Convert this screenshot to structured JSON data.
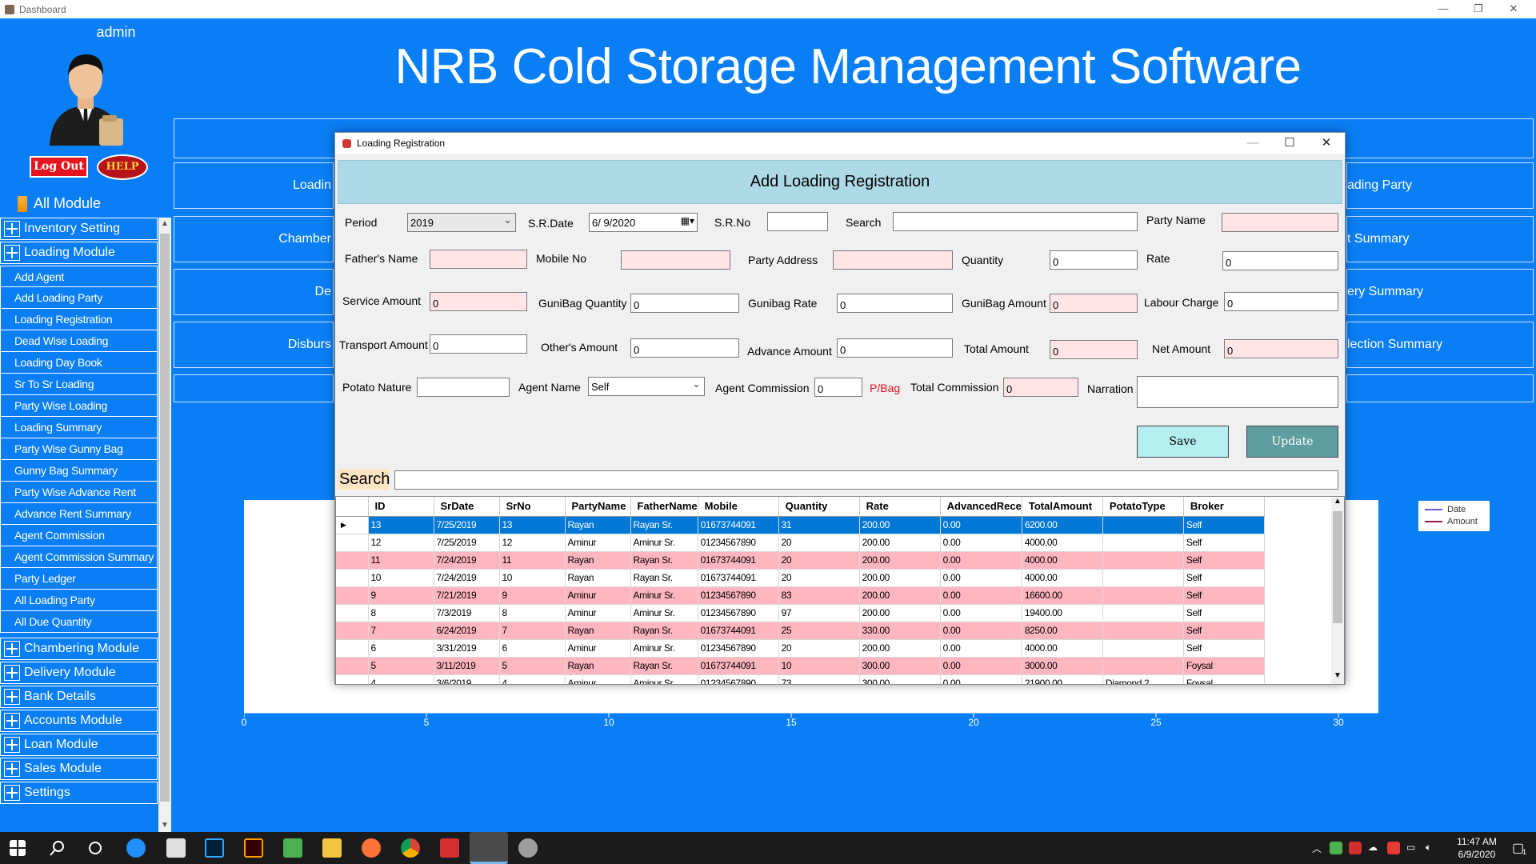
{
  "window": {
    "title": "Dashboard",
    "minimize": "—",
    "restore": "❐",
    "close": "✕"
  },
  "app_title": "NRB Cold Storage Management Software",
  "user": {
    "name": "admin",
    "logout_label": "Log Out",
    "help_label": "HELP"
  },
  "all_module_label": "All Module",
  "sidebar": {
    "modules_top": [
      {
        "label": "Inventory Setting"
      },
      {
        "label": "Loading Module"
      }
    ],
    "loading_items": [
      "Add Agent",
      "Add Loading Party",
      "Loading Registration",
      "Dead Wise Loading",
      "Loading Day Book",
      "Sr To Sr Loading",
      "Party Wise Loading",
      "Loading Summary",
      "Party Wise Gunny Bag",
      "Gunny Bag Summary",
      "Party Wise Advance Rent",
      "Advance Rent Summary",
      "Agent Commission",
      "Agent Commission Summary",
      "Party Ledger",
      "All Loading Party",
      "All Due Quantity"
    ],
    "modules_bottom": [
      {
        "label": "Chambering Module"
      },
      {
        "label": "Delivery Module"
      },
      {
        "label": "Bank Details"
      },
      {
        "label": "Accounts Module"
      },
      {
        "label": "Loan Module"
      },
      {
        "label": "Sales Module"
      },
      {
        "label": "Settings"
      }
    ]
  },
  "background_tiles": {
    "left": [
      "Loadin",
      "Chamber",
      "De",
      "Disburs"
    ],
    "right": [
      "ading Party",
      "t Summary",
      "ery Summary",
      "lection Summary"
    ]
  },
  "chart": {
    "x_ticks": [
      "0",
      "5",
      "10",
      "15",
      "20",
      "25",
      "30"
    ],
    "legend": [
      {
        "name": "Date",
        "color": "#6a5acd"
      },
      {
        "name": "Amount",
        "color": "#8b1a4a"
      }
    ]
  },
  "dialog": {
    "title": "Loading Registration",
    "header": "Add Loading Registration",
    "labels": {
      "period": "Period",
      "sr_date": "S.R.Date",
      "sr_no": "S.R.No",
      "search": "Search",
      "party_name": "Party Name",
      "fathers_name": "Father's Name",
      "mobile_no": "Mobile No",
      "party_address": "Party Address",
      "quantity": "Quantity",
      "rate": "Rate",
      "service_amount": "Service Amount",
      "gunibag_quantity": "GuniBag Quantity",
      "gunibag_rate": "Gunibag Rate",
      "gunibag_amount": "GuniBag Amount",
      "labour_charge": "Labour Charge",
      "transport_amount": "Transport Amount",
      "others_amount": "Other's Amount",
      "advance_amount": "Advance Amount",
      "total_amount": "Total Amount",
      "net_amount": "Net Amount",
      "potato_nature": "Potato Nature",
      "agent_name": "Agent Name",
      "agent_commission": "Agent Commission",
      "p_bag": "P/Bag",
      "total_commission": "Total Commission",
      "narration": "Narration"
    },
    "values": {
      "period": "2019",
      "sr_date": "6/ 9/2020",
      "sr_no": "",
      "search": "",
      "party_name": "",
      "fathers_name": "",
      "mobile_no": "",
      "party_address": "",
      "quantity": "0",
      "rate": "0",
      "service_amount": "0",
      "gunibag_quantity": "0",
      "gunibag_rate": "0",
      "gunibag_amount": "0",
      "labour_charge": "0",
      "transport_amount": "0",
      "others_amount": "0",
      "advance_amount": "0",
      "total_amount": "0",
      "net_amount": "0",
      "potato_nature": "",
      "agent_name": "Self",
      "agent_commission": "0",
      "total_commission": "0",
      "narration": ""
    },
    "save_label": "Save",
    "update_label": "Update",
    "grid_search_label": "Search",
    "grid_search_value": "",
    "grid": {
      "columns": [
        "ID",
        "SrDate",
        "SrNo",
        "PartyName",
        "FatherName",
        "Mobile",
        "Quantity",
        "Rate",
        "AdvancedRece",
        "TotalAmount",
        "PotatoType",
        "Broker"
      ],
      "rows": [
        [
          "13",
          "7/25/2019",
          "13",
          "Rayan",
          "Rayan Sr.",
          "01673744091",
          "31",
          "200.00",
          "0.00",
          "6200.00",
          "",
          "Self"
        ],
        [
          "12",
          "7/25/2019",
          "12",
          "Aminur",
          "Aminur Sr.",
          "01234567890",
          "20",
          "200.00",
          "0.00",
          "4000.00",
          "",
          "Self"
        ],
        [
          "11",
          "7/24/2019",
          "11",
          "Rayan",
          "Rayan Sr.",
          "01673744091",
          "20",
          "200.00",
          "0.00",
          "4000.00",
          "",
          "Self"
        ],
        [
          "10",
          "7/24/2019",
          "10",
          "Rayan",
          "Rayan Sr.",
          "01673744091",
          "20",
          "200.00",
          "0.00",
          "4000.00",
          "",
          "Self"
        ],
        [
          "9",
          "7/21/2019",
          "9",
          "Aminur",
          "Aminur Sr.",
          "01234567890",
          "83",
          "200.00",
          "0.00",
          "16600.00",
          "",
          "Self"
        ],
        [
          "8",
          "7/3/2019",
          "8",
          "Aminur",
          "Aminur Sr.",
          "01234567890",
          "97",
          "200.00",
          "0.00",
          "19400.00",
          "",
          "Self"
        ],
        [
          "7",
          "6/24/2019",
          "7",
          "Rayan",
          "Rayan Sr.",
          "01673744091",
          "25",
          "330.00",
          "0.00",
          "8250.00",
          "",
          "Self"
        ],
        [
          "6",
          "3/31/2019",
          "6",
          "Aminur",
          "Aminur Sr.",
          "01234567890",
          "20",
          "200.00",
          "0.00",
          "4000.00",
          "",
          "Self"
        ],
        [
          "5",
          "3/11/2019",
          "5",
          "Rayan",
          "Rayan Sr.",
          "01673744091",
          "10",
          "300.00",
          "0.00",
          "3000.00",
          "",
          "Foysal"
        ],
        [
          "4",
          "3/6/2019",
          "4",
          "Aminur",
          "Aminur Sr.",
          "01234567890",
          "73",
          "300.00",
          "0.00",
          "21900.00",
          "Diamond 2",
          "Foysal"
        ]
      ]
    }
  },
  "taskbar": {
    "clock_time": "11:47 AM",
    "clock_date": "6/9/2020",
    "notification_count": "1"
  }
}
